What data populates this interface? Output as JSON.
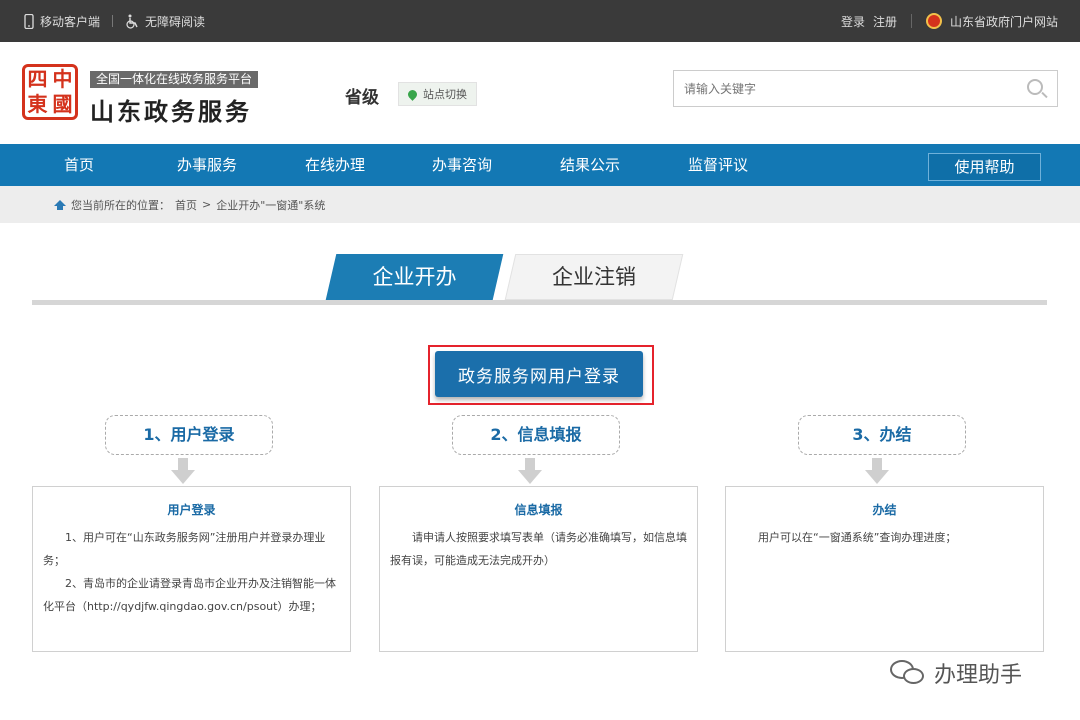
{
  "topbar": {
    "mobile_client": "移动客户端",
    "accessible_reading": "无障碍阅读",
    "login": "登录",
    "register": "注册",
    "gov_portal": "山东省政府门户网站"
  },
  "header": {
    "seal_chars": [
      "四",
      "中",
      "東",
      "國"
    ],
    "platform_subtitle": "全国一体化在线政务服务平台",
    "site_title": "山东政务服务",
    "level": "省级",
    "site_switch": "站点切换",
    "search_placeholder": "请输入关键字"
  },
  "nav": {
    "items": [
      "首页",
      "办事服务",
      "在线办理",
      "办事咨询",
      "结果公示",
      "监督评议"
    ],
    "help": "使用帮助"
  },
  "breadcrumb": {
    "prefix": "您当前所在的位置：",
    "home": "首页",
    "sep": ">",
    "current": "企业开办\"一窗通\"系统"
  },
  "tabs": {
    "active": "企业开办",
    "inactive": "企业注销"
  },
  "login_button": "政务服务网用户登录",
  "steps": [
    {
      "pill": "1、用户登录",
      "card_title": "用户登录",
      "paragraphs": [
        "1、用户可在“山东政务服务网”注册用户并登录办理业务；",
        "2、青岛市的企业请登录青岛市企业开办及注销智能一体化平台（http://qydjfw.qingdao.gov.cn/psout）办理；"
      ]
    },
    {
      "pill": "2、信息填报",
      "card_title": "信息填报",
      "paragraphs": [
        "请申请人按照要求填写表单（请务必准确填写，如信息填报有误，可能造成无法完成开办）"
      ]
    },
    {
      "pill": "3、办结",
      "card_title": "办结",
      "paragraphs": [
        "用户可以在“一窗通系统”查询办理进度；"
      ]
    }
  ],
  "watermark": "办理助手",
  "colors": {
    "topbar": "#3a3a3a",
    "nav": "#1378b4",
    "accent_blue": "#1a6aa5",
    "highlight_red": "#e5232c",
    "seal_red": "#d4321c"
  }
}
